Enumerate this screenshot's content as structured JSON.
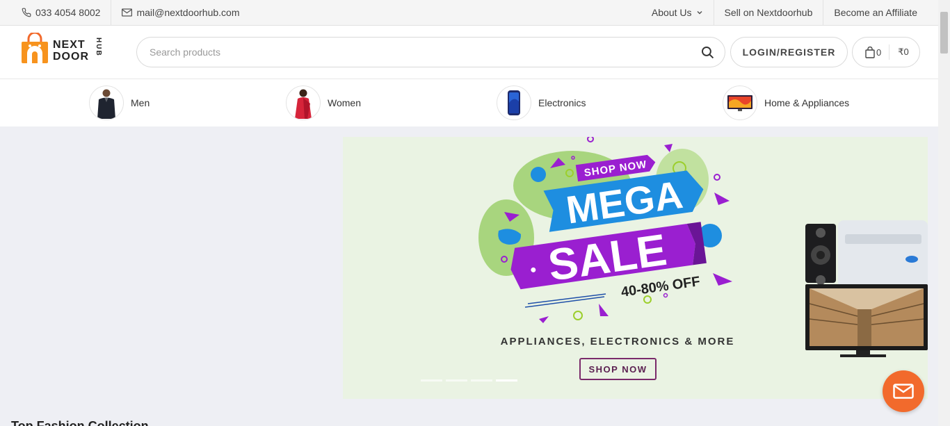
{
  "topbar": {
    "phone": "033 4054 8002",
    "email": "mail@nextdoorhub.com",
    "links": [
      "About Us",
      "Sell on Nextdoorhub",
      "Become an Affiliate"
    ]
  },
  "header": {
    "logo_line1": "NEXT",
    "logo_line2": "DOOR",
    "logo_hub": "HUB",
    "search_placeholder": "Search products",
    "login_label": "LOGIN/REGISTER",
    "cart_count": "0",
    "cart_total": "₹0"
  },
  "categories": [
    {
      "label": "Men"
    },
    {
      "label": "Women"
    },
    {
      "label": "Electronics"
    },
    {
      "label": "Home & Appliances"
    }
  ],
  "banner": {
    "tag": "SHOP NOW",
    "headline1": "MEGA",
    "headline2": "SALE",
    "discount": "40-80% OFF",
    "subtitle": "APPLIANCES, ELECTRONICS & MORE",
    "button": "SHOP NOW",
    "slides": 4,
    "active_slide": 3
  },
  "section_title": "Top Fashion Collection",
  "colors": {
    "accent": "#f26a2c",
    "banner_bg": "#eaf3e3",
    "banner_blue": "#1e8ee0",
    "banner_purple": "#9a1fd0",
    "page_bg": "#eeeff4"
  },
  "icons": {
    "phone": "phone-icon",
    "mail": "mail-icon",
    "search": "search-icon",
    "cart": "bag-icon",
    "chat": "envelope-icon"
  }
}
